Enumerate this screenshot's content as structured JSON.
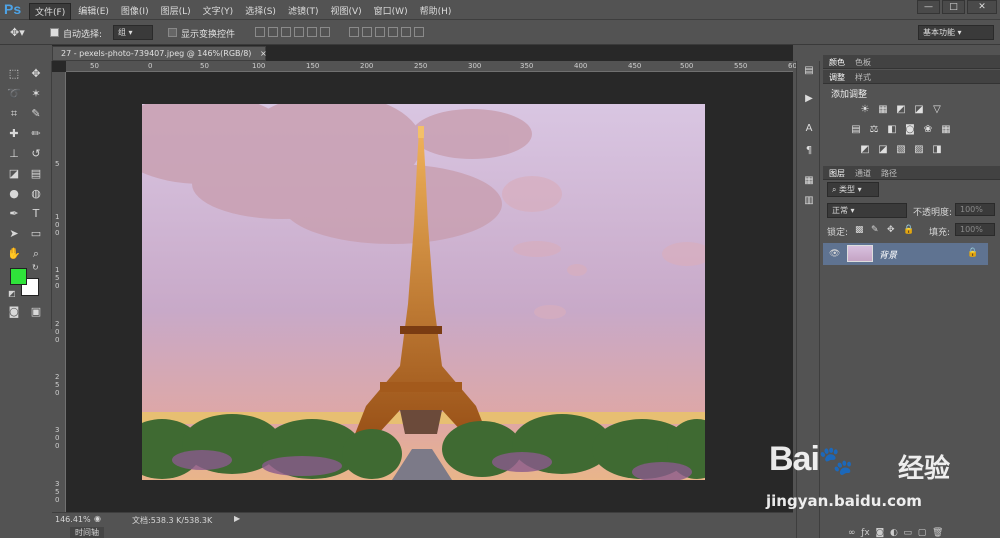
{
  "app": {
    "logo": "Ps"
  },
  "menu": [
    "文件(F)",
    "编辑(E)",
    "图像(I)",
    "图层(L)",
    "文字(Y)",
    "选择(S)",
    "滤镜(T)",
    "视图(V)",
    "窗口(W)",
    "帮助(H)"
  ],
  "window_controls": {
    "minimize": "—",
    "restore": "□",
    "close": "✕"
  },
  "options": {
    "auto_select_label": "自动选择:",
    "auto_select_value": "组",
    "show_transform_label": "显示变换控件",
    "workspace": "基本功能"
  },
  "document": {
    "tab_title": "27 - pexels-photo-739407.jpeg @ 146%(RGB/8)",
    "tab_close": "×"
  },
  "ruler": {
    "top": [
      "50",
      "0",
      "50",
      "100",
      "150",
      "200",
      "250",
      "300",
      "350",
      "400",
      "450",
      "500",
      "550",
      "600",
      "650"
    ],
    "left": [
      "5",
      "1 0 0",
      "1 5 0",
      "2 0 0",
      "2 5 0",
      "3 0 0",
      "3 5 0"
    ]
  },
  "status": {
    "zoom": "146.41%",
    "doc_info": "文档:538.3 K/538.3K"
  },
  "timeline": {
    "label": "时间轴"
  },
  "panels": {
    "color_tabs": [
      "颜色",
      "色板"
    ],
    "adjust_tabs": [
      "调整",
      "样式"
    ],
    "adjust_title": "添加调整",
    "layers_tabs": [
      "图层",
      "通道",
      "路径"
    ],
    "kind_filter": "类型",
    "blend_mode": "正常",
    "opacity_label": "不透明度:",
    "opacity_value": "100%",
    "lock_label": "锁定:",
    "fill_label": "填充:",
    "fill_value": "100%",
    "layer_name": "背景"
  },
  "watermark": {
    "brand": "Bai",
    "brand2": "du",
    "cn": "经验",
    "url": "jingyan.baidu.com"
  },
  "colors": {
    "foreground": "#2fe33a",
    "background": "#ffffff",
    "accent": "#4ea3e6",
    "layer_selected": "#5f7391"
  }
}
